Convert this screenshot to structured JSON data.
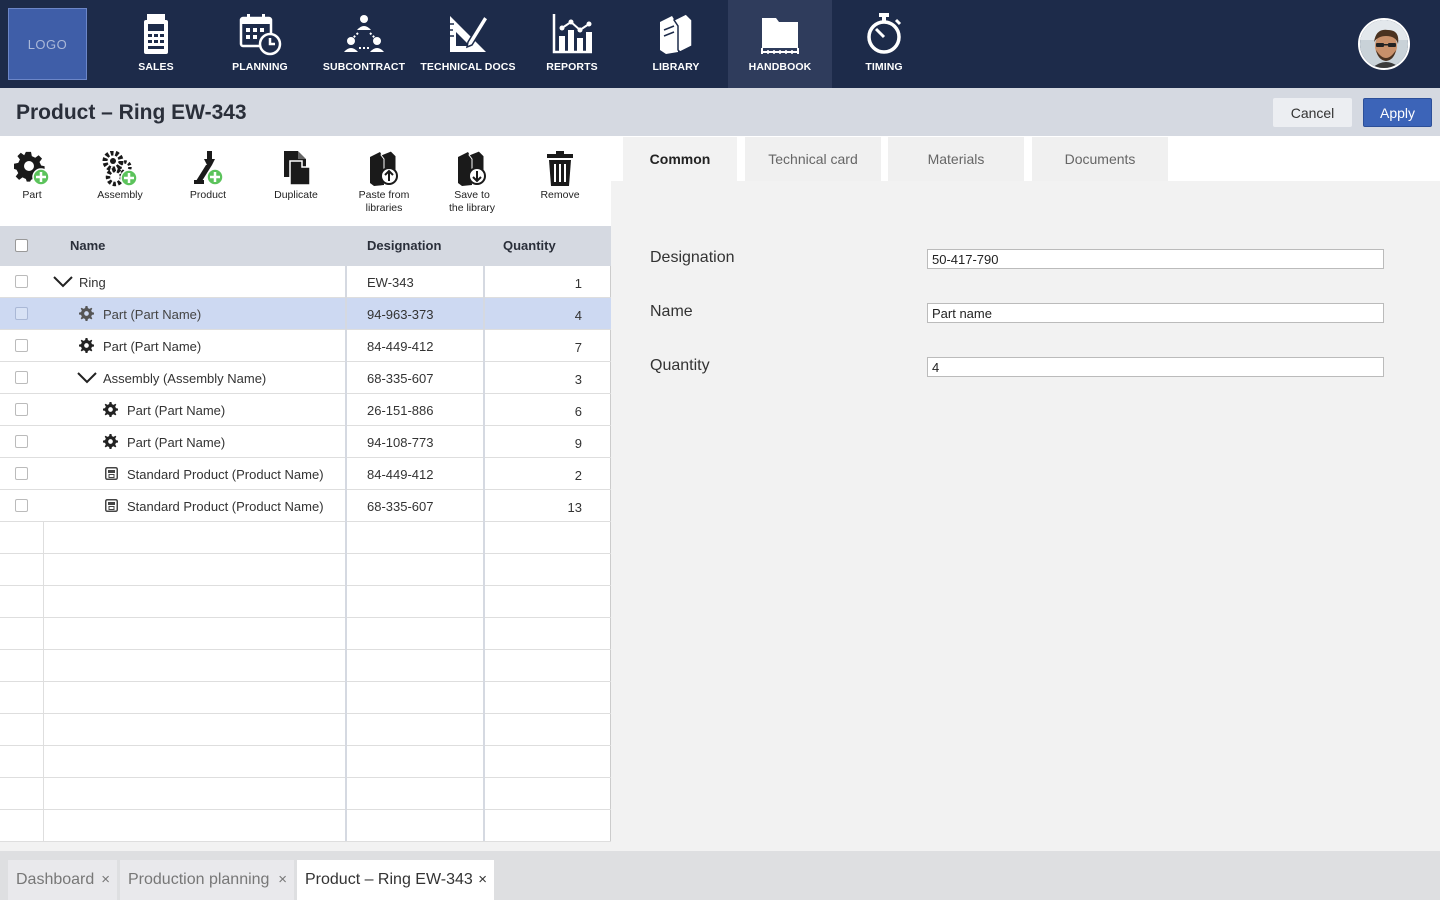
{
  "nav": {
    "logo": "LOGO",
    "items": [
      {
        "label": "SALES",
        "icon": "sales-icon"
      },
      {
        "label": "PLANNING",
        "icon": "planning-icon"
      },
      {
        "label": "SUBCONTRACT",
        "icon": "subcontract-icon"
      },
      {
        "label": "TECHNICAL DOCS",
        "icon": "technical-docs-icon"
      },
      {
        "label": "REPORTS",
        "icon": "reports-icon"
      },
      {
        "label": "LIBRARY",
        "icon": "library-icon"
      },
      {
        "label": "HANDBOOK",
        "icon": "handbook-icon",
        "active": true
      },
      {
        "label": "TIMING",
        "icon": "timing-icon"
      }
    ]
  },
  "header": {
    "title": "Product – Ring EW-343",
    "cancel_label": "Cancel",
    "apply_label": "Apply"
  },
  "toolbar": {
    "part": "Part",
    "assembly": "Assembly",
    "product": "Product",
    "duplicate": "Duplicate",
    "paste_line1": "Paste from",
    "paste_line2": "libraries",
    "save_line1": "Save to",
    "save_line2": "the library",
    "remove": "Remove"
  },
  "table": {
    "columns": {
      "name": "Name",
      "designation": "Designation",
      "quantity": "Quantity"
    },
    "rows": [
      {
        "name": "Ring",
        "designation": "EW-343",
        "quantity": "1"
      },
      {
        "name": "Part (Part Name)",
        "designation": "94-963-373",
        "quantity": "4"
      },
      {
        "name": "Part (Part Name)",
        "designation": "84-449-412",
        "quantity": "7"
      },
      {
        "name": "Assembly (Assembly Name)",
        "designation": "68-335-607",
        "quantity": "3"
      },
      {
        "name": "Part (Part Name)",
        "designation": "26-151-886",
        "quantity": "6"
      },
      {
        "name": "Part (Part Name)",
        "designation": "94-108-773",
        "quantity": "9"
      },
      {
        "name": "Standard Product (Product Name)",
        "designation": "84-449-412",
        "quantity": "2"
      },
      {
        "name": "Standard Product (Product Name)",
        "designation": "68-335-607",
        "quantity": "13"
      }
    ]
  },
  "tabs": {
    "common": "Common",
    "technical_card": "Technical card",
    "materials": "Materials",
    "documents": "Documents"
  },
  "form": {
    "designation_label": "Designation",
    "designation_value": "50-417-790",
    "name_label": "Name",
    "name_value": "Part name",
    "quantity_label": "Quantity",
    "quantity_value": "4"
  },
  "bottom_tabs": {
    "dashboard": "Dashboard",
    "production_planning": "Production planning",
    "current": "Product – Ring EW-343",
    "close_glyph": "×"
  },
  "colors": {
    "nav_bg": "#1d2b4a",
    "accent": "#3c64b8",
    "selected_row": "#cdd9f2",
    "add_badge": "#5cc35c"
  }
}
